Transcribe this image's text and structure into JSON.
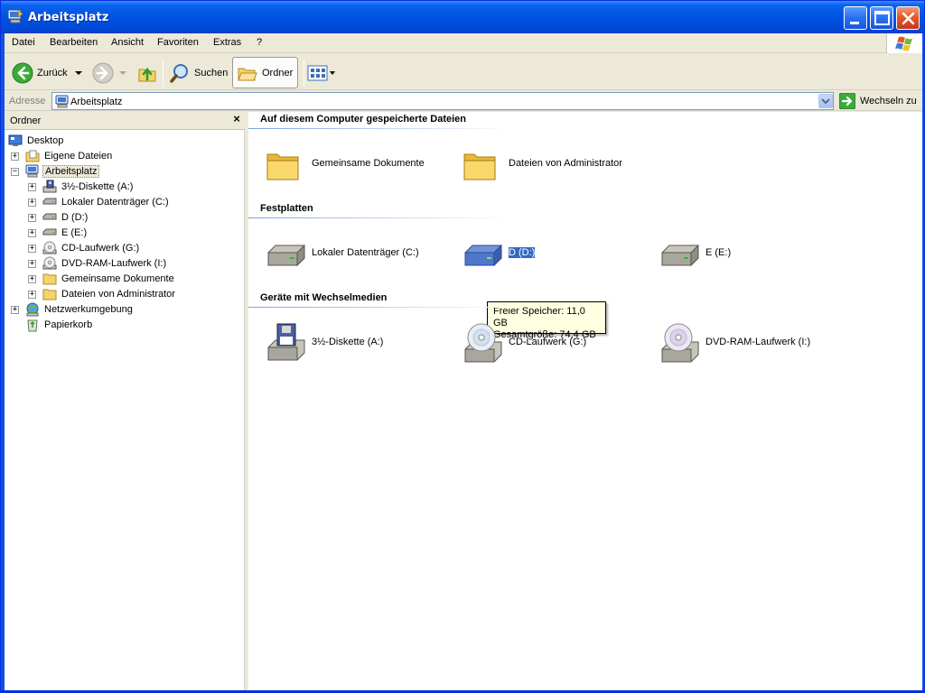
{
  "window": {
    "title": "Arbeitsplatz"
  },
  "menu": {
    "items": [
      "Datei",
      "Bearbeiten",
      "Ansicht",
      "Favoriten",
      "Extras",
      "?"
    ]
  },
  "toolbar": {
    "back_label": "Zurück",
    "search_label": "Suchen",
    "folders_label": "Ordner"
  },
  "address": {
    "label": "Adresse",
    "value": "Arbeitsplatz",
    "go_label": "Wechseln zu"
  },
  "folder_pane": {
    "title": "Ordner",
    "close_glyph": "×",
    "items": [
      {
        "label": "Desktop",
        "icon": "desktop-icon"
      },
      {
        "label": "Eigene Dateien",
        "icon": "my-documents-icon"
      },
      {
        "label": "Arbeitsplatz",
        "icon": "my-computer-icon"
      },
      {
        "label": "3½-Diskette (A:)",
        "icon": "floppy-icon"
      },
      {
        "label": "Lokaler Datenträger (C:)",
        "icon": "hard-drive-icon"
      },
      {
        "label": "D (D:)",
        "icon": "hard-drive-icon"
      },
      {
        "label": "E (E:)",
        "icon": "hard-drive-icon"
      },
      {
        "label": "CD-Laufwerk (G:)",
        "icon": "cd-drive-icon"
      },
      {
        "label": "DVD-RAM-Laufwerk (I:)",
        "icon": "dvd-drive-icon"
      },
      {
        "label": "Gemeinsame Dokumente",
        "icon": "folder-icon"
      },
      {
        "label": "Dateien von Administrator",
        "icon": "folder-icon"
      },
      {
        "label": "Netzwerkumgebung",
        "icon": "network-icon"
      },
      {
        "label": "Papierkorb",
        "icon": "recycle-bin-icon"
      }
    ]
  },
  "content": {
    "groups": [
      {
        "title": "Auf diesem Computer gespeicherte Dateien",
        "items": [
          {
            "label": "Gemeinsame Dokumente",
            "icon": "folder-icon"
          },
          {
            "label": "Dateien von Administrator",
            "icon": "folder-icon"
          }
        ]
      },
      {
        "title": "Festplatten",
        "items": [
          {
            "label": "Lokaler Datenträger (C:)",
            "icon": "hard-drive-icon"
          },
          {
            "label": "D (D:)",
            "icon": "hard-drive-icon"
          },
          {
            "label": "E (E:)",
            "icon": "hard-drive-icon"
          }
        ]
      },
      {
        "title": "Geräte mit Wechselmedien",
        "items": [
          {
            "label": "3½-Diskette (A:)",
            "icon": "floppy-drive-icon"
          },
          {
            "label": "CD-Laufwerk (G:)",
            "icon": "cd-drive-icon"
          },
          {
            "label": "DVD-RAM-Laufwerk (I:)",
            "icon": "dvd-drive-icon"
          }
        ]
      }
    ],
    "tooltip": {
      "line1": "Freier Speicher: 11,0 GB",
      "line2": "Gesamtgröße: 74,4 GB"
    }
  },
  "colors": {
    "title_bar": "#0054e3",
    "selection": "#316ac5",
    "tooltip_bg": "#ffffe1"
  }
}
